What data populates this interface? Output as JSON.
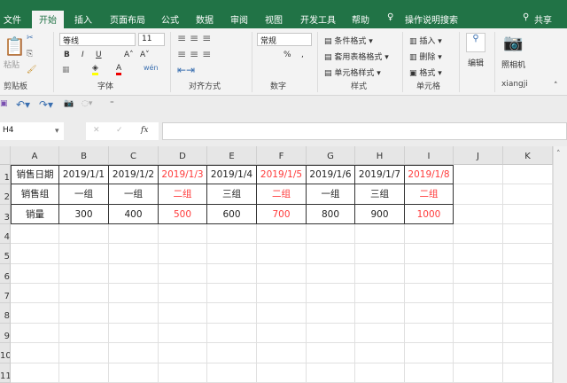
{
  "tabs": [
    "文件",
    "开始",
    "插入",
    "页面布局",
    "公式",
    "数据",
    "审阅",
    "视图",
    "开发工具",
    "帮助"
  ],
  "tell_me": "操作说明搜索",
  "share": "共享",
  "ribbon": {
    "paste": "粘贴",
    "clipboard": "剪贴板",
    "font_name": "等线",
    "font_size": "11",
    "font_group": "字体",
    "align_group": "对齐方式",
    "number_format": "常规",
    "number_group": "数字",
    "percent": "%",
    "comma": ",",
    "cond_format": "条件格式",
    "table_format": "套用表格格式",
    "cell_style": "单元格样式",
    "styles_group": "样式",
    "insert": "插入",
    "delete": "删除",
    "format": "格式",
    "cells_group": "单元格",
    "edit": "编辑",
    "camera": "照相机",
    "camera_group": "xiangji"
  },
  "name_box": "H4",
  "fx": "fx",
  "columns": [
    "A",
    "B",
    "C",
    "D",
    "E",
    "F",
    "G",
    "H",
    "I",
    "J",
    "K"
  ],
  "rows": [
    "1",
    "2",
    "3",
    "4",
    "5",
    "6",
    "7",
    "8",
    "9",
    "10",
    "11"
  ],
  "table": [
    [
      {
        "v": "销售日期",
        "r": false
      },
      {
        "v": "2019/1/1",
        "r": false
      },
      {
        "v": "2019/1/2",
        "r": false
      },
      {
        "v": "2019/1/3",
        "r": true
      },
      {
        "v": "2019/1/4",
        "r": false
      },
      {
        "v": "2019/1/5",
        "r": true
      },
      {
        "v": "2019/1/6",
        "r": false
      },
      {
        "v": "2019/1/7",
        "r": false
      },
      {
        "v": "2019/1/8",
        "r": true
      }
    ],
    [
      {
        "v": "销售组",
        "r": false
      },
      {
        "v": "一组",
        "r": false
      },
      {
        "v": "一组",
        "r": false
      },
      {
        "v": "二组",
        "r": true
      },
      {
        "v": "三组",
        "r": false
      },
      {
        "v": "二组",
        "r": true
      },
      {
        "v": "一组",
        "r": false
      },
      {
        "v": "三组",
        "r": false
      },
      {
        "v": "二组",
        "r": true
      }
    ],
    [
      {
        "v": "销量",
        "r": false
      },
      {
        "v": "300",
        "r": false
      },
      {
        "v": "400",
        "r": false
      },
      {
        "v": "500",
        "r": true
      },
      {
        "v": "600",
        "r": false
      },
      {
        "v": "700",
        "r": true
      },
      {
        "v": "800",
        "r": false
      },
      {
        "v": "900",
        "r": false
      },
      {
        "v": "1000",
        "r": true
      }
    ]
  ]
}
